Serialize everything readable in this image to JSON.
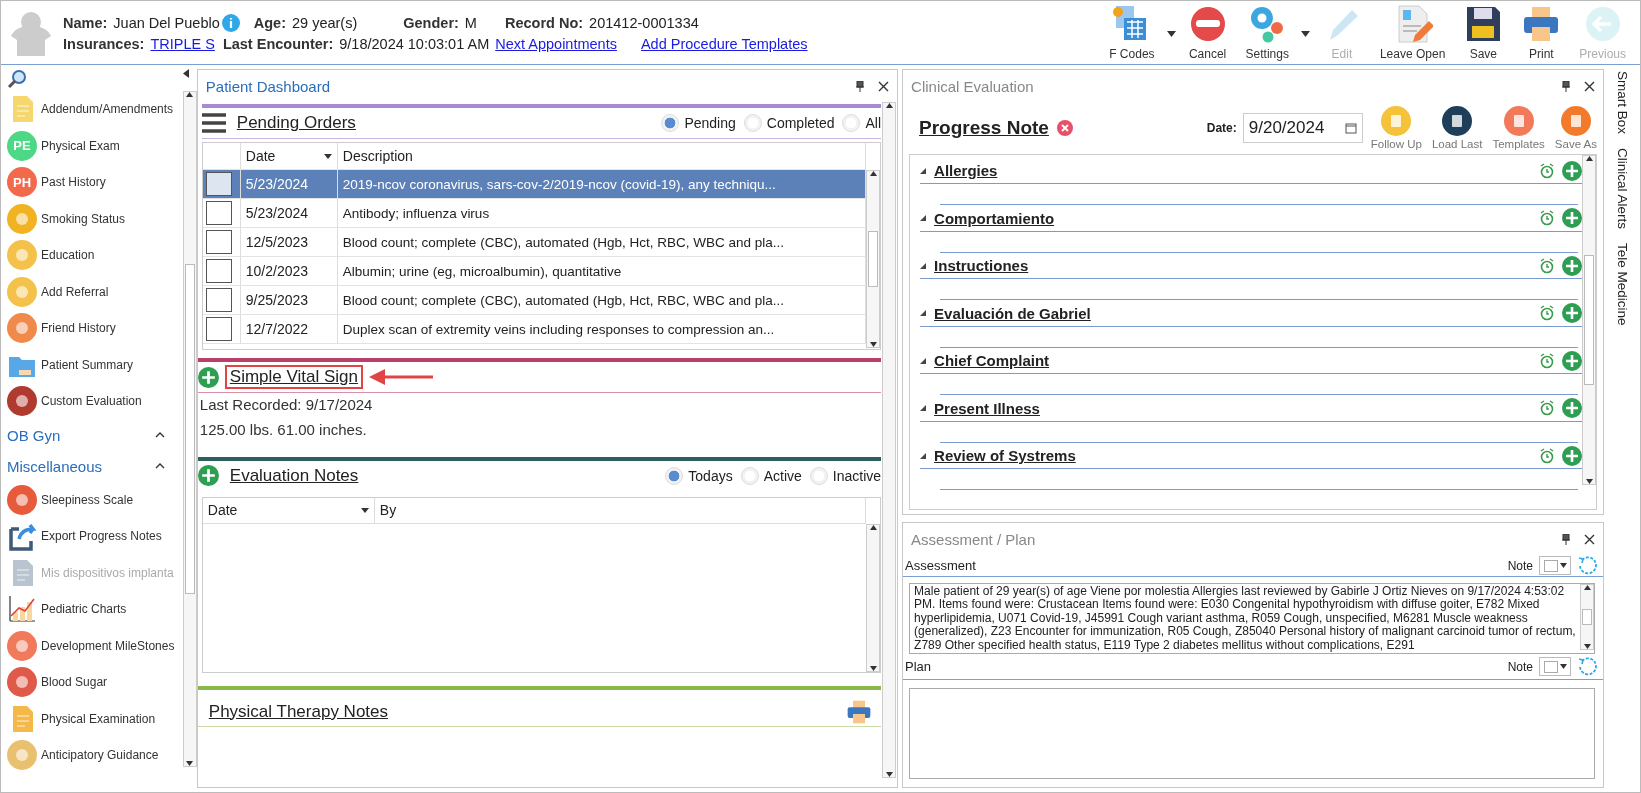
{
  "patient": {
    "name_label": "Name:",
    "name": "Juan Del Pueblo",
    "age_label": "Age:",
    "age": "29 year(s)",
    "gender_label": "Gender:",
    "gender": "M",
    "record_label": "Record No:",
    "record": "201412-0001334",
    "insurance_label": "Insurances:",
    "insurance": "TRIPLE S",
    "encounter_label": "Last Encounter:",
    "encounter": "9/18/2024 10:03:01 AM",
    "links": [
      "Next Appointments",
      "Add Procedure Templates"
    ]
  },
  "toolbar": [
    {
      "label": "F Codes",
      "disabled": false,
      "dropdown": true
    },
    {
      "label": "Cancel",
      "disabled": false,
      "dropdown": false
    },
    {
      "label": "Settings",
      "disabled": false,
      "dropdown": true
    },
    {
      "label": "Edit",
      "disabled": true,
      "dropdown": false
    },
    {
      "label": "Leave Open",
      "disabled": false,
      "dropdown": false
    },
    {
      "label": "Save",
      "disabled": false,
      "dropdown": false
    },
    {
      "label": "Print",
      "disabled": false,
      "dropdown": false
    },
    {
      "label": "Previous",
      "disabled": true,
      "dropdown": false
    }
  ],
  "sidebar": {
    "groups": [
      {
        "items": [
          {
            "label": "Addendum/Amendments",
            "disabled": false
          },
          {
            "label": "Physical Exam",
            "disabled": false,
            "badge": "PE"
          },
          {
            "label": "Past History",
            "disabled": false,
            "badge": "PH"
          },
          {
            "label": "Smoking Status",
            "disabled": false
          },
          {
            "label": "Education",
            "disabled": false
          },
          {
            "label": "Add Referral",
            "disabled": false
          },
          {
            "label": "Friend History",
            "disabled": false
          },
          {
            "label": "Patient Summary",
            "disabled": false
          },
          {
            "label": "Custom Evaluation",
            "disabled": false
          }
        ]
      },
      {
        "title": "OB Gyn"
      },
      {
        "title": "Miscellaneous",
        "items": [
          {
            "label": "Sleepiness Scale",
            "disabled": false
          },
          {
            "label": "Export Progress Notes",
            "disabled": false
          },
          {
            "label": "Mis dispositivos implanta",
            "disabled": true
          },
          {
            "label": "Pediatric Charts",
            "disabled": false
          },
          {
            "label": "Development MileStones",
            "disabled": false
          },
          {
            "label": "Blood Sugar",
            "disabled": false
          },
          {
            "label": "Physical Examination",
            "disabled": false
          },
          {
            "label": "Anticipatory Guidance",
            "disabled": false
          }
        ]
      }
    ]
  },
  "dashboard": {
    "title": "Patient Dashboard",
    "pending_orders": {
      "title": "Pending Orders",
      "filters": [
        {
          "label": "Pending",
          "selected": true
        },
        {
          "label": "Completed",
          "selected": false
        },
        {
          "label": "All",
          "selected": false
        }
      ],
      "columns": [
        "Date",
        "Description"
      ],
      "rows": [
        {
          "date": "5/23/2024",
          "description": "2019-ncov coronavirus, sars-cov-2/2019-ncov (covid-19), any techniqu...",
          "selected": true
        },
        {
          "date": "5/23/2024",
          "description": "Antibody; influenza virus",
          "selected": false
        },
        {
          "date": "12/5/2023",
          "description": "Blood count; complete (CBC), automated (Hgb, Hct, RBC, WBC and pla...",
          "selected": false
        },
        {
          "date": "10/2/2023",
          "description": "Albumin; urine (eg, microalbumin), quantitative",
          "selected": false
        },
        {
          "date": "9/25/2023",
          "description": "Blood count; complete (CBC), automated (Hgb, Hct, RBC, WBC and pla...",
          "selected": false
        },
        {
          "date": "12/7/2022",
          "description": "Duplex scan of extremity veins including responses to compression an...",
          "selected": false
        }
      ]
    },
    "vital_sign": {
      "title": "Simple Vital Sign",
      "highlighted": true,
      "last_recorded": "Last Recorded: 9/17/2024",
      "values": "125.00 lbs. 61.00 inches."
    },
    "evaluation_notes": {
      "title": "Evaluation Notes",
      "filters": [
        {
          "label": "Todays",
          "selected": true
        },
        {
          "label": "Active",
          "selected": false
        },
        {
          "label": "Inactive",
          "selected": false
        }
      ],
      "columns": [
        "Date",
        "By"
      ]
    },
    "physical_therapy": {
      "title": "Physical Therapy Notes"
    }
  },
  "clinical_evaluation": {
    "title": "Clinical Evaluation",
    "note_title": "Progress Note",
    "date_label": "Date:",
    "date": "9/20/2024",
    "actions": [
      "Follow Up",
      "Load Last",
      "Templates",
      "Save As"
    ],
    "sections": [
      "Allergies",
      "Comportamiento",
      "Instructiones",
      "Evaluación de Gabriel",
      "Chief Complaint",
      "Present Illness",
      "Review of Systrems"
    ]
  },
  "assessment_plan": {
    "title": "Assessment / Plan",
    "assessment_label": "Assessment",
    "note_label": "Note",
    "assessment_text": "Male patient of 29 year(s) of age Viene por molestia     Allergies last reviewed by Gabirle J Ortiz Nieves on 9/17/2024 4:53:02 PM.    Items found were:  Crustacean  Items found were:  E030 Congenital hypothyroidism with diffuse goiter, E782 Mixed hyperlipidemia, U071 Covid-19, J45991 Cough variant asthma, R059 Cough, unspecified, M6281 Muscle weakness (generalized), Z23 Encounter for immunization, R05 Cough, Z85040 Personal history of malignant carcinoid tumor of rectum, Z789 Other specified health status, E119 Type 2 diabetes mellitus without complications, E291",
    "plan_label": "Plan",
    "plan_note_label": "Note"
  },
  "side_tabs": [
    "Smart Box",
    "Clinical Alerts",
    "Tele Medicine"
  ]
}
